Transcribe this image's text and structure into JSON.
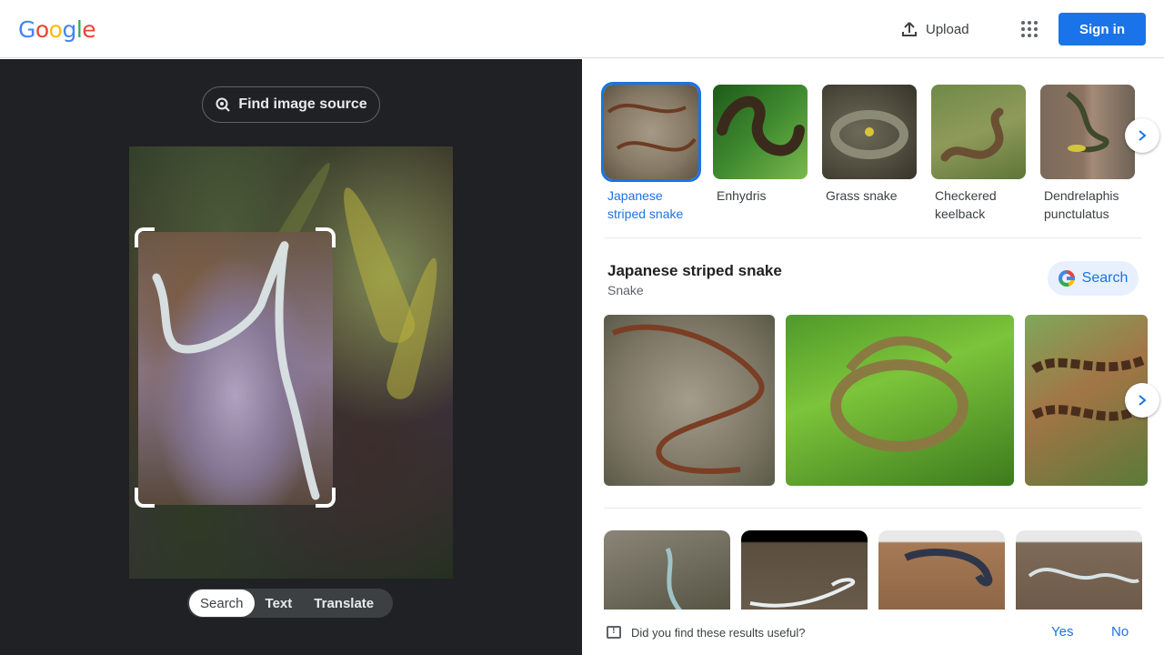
{
  "header": {
    "logo_letters": [
      "G",
      "o",
      "o",
      "g",
      "l",
      "e"
    ],
    "upload_label": "Upload",
    "apps_icon": "apps-grid-icon",
    "signin_label": "Sign in"
  },
  "lens": {
    "find_source_label": "Find image source",
    "modes": [
      {
        "label": "Search",
        "active": true
      },
      {
        "label": "Text",
        "active": false
      },
      {
        "label": "Translate",
        "active": false
      }
    ]
  },
  "suggestions": [
    {
      "label": "Japanese striped snake",
      "active": true
    },
    {
      "label": "Enhydris",
      "active": false
    },
    {
      "label": "Grass snake",
      "active": false
    },
    {
      "label": "Checkered keelback",
      "active": false
    },
    {
      "label": "Dendrelaphis punctulatus",
      "active": false
    }
  ],
  "knowledge_panel": {
    "title": "Japanese striped snake",
    "subtitle": "Snake",
    "search_label": "Search"
  },
  "feedback": {
    "question": "Did you find these results useful?",
    "yes_label": "Yes",
    "no_label": "No"
  },
  "colors": {
    "accent": "#1a73e8",
    "left_pane_bg": "#202124"
  }
}
